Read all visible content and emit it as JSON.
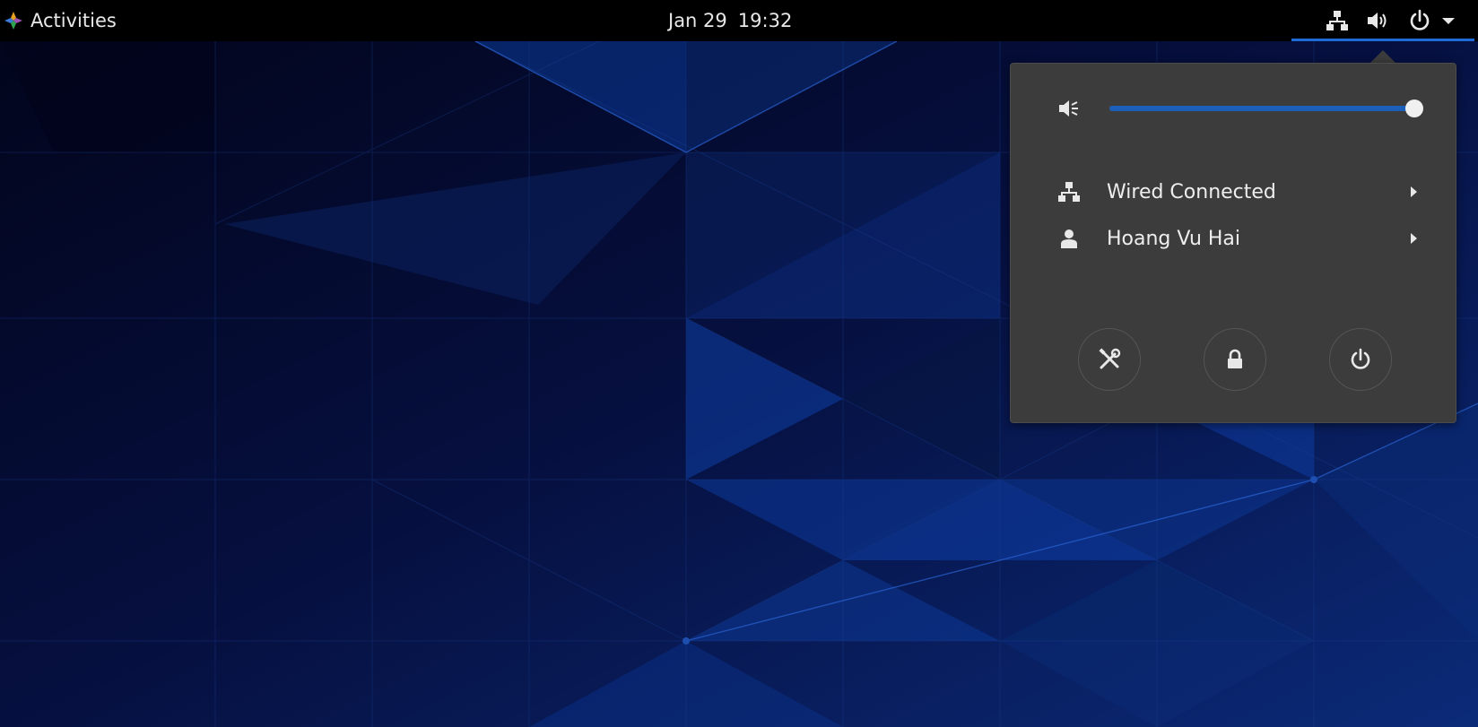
{
  "topbar": {
    "activities_label": "Activities",
    "date": "Jan 29",
    "time": "19:32",
    "status_icons": [
      "network-wired-icon",
      "volume-high-icon",
      "power-icon",
      "dropdown-arrow-icon"
    ]
  },
  "menu": {
    "volume": {
      "icon": "volume-muted-icon",
      "level": 1.0
    },
    "items": [
      {
        "icon": "network-wired-icon",
        "label": "Wired Connected",
        "has_submenu": true
      },
      {
        "icon": "user-icon",
        "label": "Hoang Vu Hai",
        "has_submenu": true
      }
    ],
    "actions": [
      {
        "icon": "settings-tools-icon",
        "name": "settings"
      },
      {
        "icon": "lock-icon",
        "name": "lock"
      },
      {
        "icon": "power-icon",
        "name": "power-off"
      }
    ]
  },
  "colors": {
    "topbar_bg": "#000000",
    "menu_bg": "#3c3c3c",
    "accent": "#1b5fb8",
    "wallpaper_dark": "#050a28",
    "wallpaper_blue": "#0a3a8c"
  }
}
